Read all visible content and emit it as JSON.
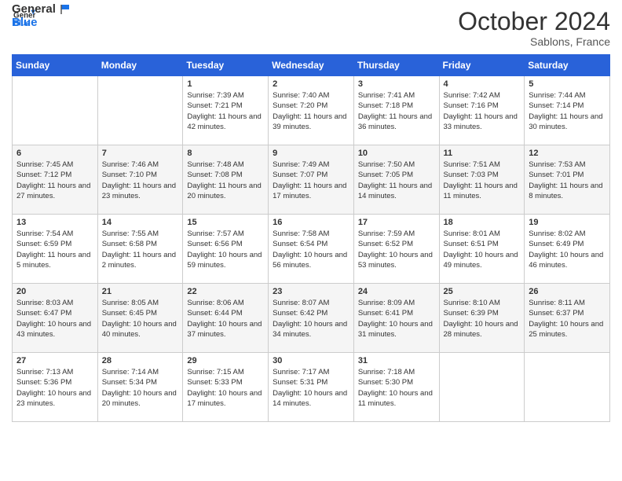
{
  "header": {
    "logo_line1": "General",
    "logo_line2": "Blue",
    "month": "October 2024",
    "location": "Sablons, France"
  },
  "days_of_week": [
    "Sunday",
    "Monday",
    "Tuesday",
    "Wednesday",
    "Thursday",
    "Friday",
    "Saturday"
  ],
  "weeks": [
    [
      {
        "day": "",
        "sunrise": "",
        "sunset": "",
        "daylight": ""
      },
      {
        "day": "",
        "sunrise": "",
        "sunset": "",
        "daylight": ""
      },
      {
        "day": "1",
        "sunrise": "Sunrise: 7:39 AM",
        "sunset": "Sunset: 7:21 PM",
        "daylight": "Daylight: 11 hours and 42 minutes."
      },
      {
        "day": "2",
        "sunrise": "Sunrise: 7:40 AM",
        "sunset": "Sunset: 7:20 PM",
        "daylight": "Daylight: 11 hours and 39 minutes."
      },
      {
        "day": "3",
        "sunrise": "Sunrise: 7:41 AM",
        "sunset": "Sunset: 7:18 PM",
        "daylight": "Daylight: 11 hours and 36 minutes."
      },
      {
        "day": "4",
        "sunrise": "Sunrise: 7:42 AM",
        "sunset": "Sunset: 7:16 PM",
        "daylight": "Daylight: 11 hours and 33 minutes."
      },
      {
        "day": "5",
        "sunrise": "Sunrise: 7:44 AM",
        "sunset": "Sunset: 7:14 PM",
        "daylight": "Daylight: 11 hours and 30 minutes."
      }
    ],
    [
      {
        "day": "6",
        "sunrise": "Sunrise: 7:45 AM",
        "sunset": "Sunset: 7:12 PM",
        "daylight": "Daylight: 11 hours and 27 minutes."
      },
      {
        "day": "7",
        "sunrise": "Sunrise: 7:46 AM",
        "sunset": "Sunset: 7:10 PM",
        "daylight": "Daylight: 11 hours and 23 minutes."
      },
      {
        "day": "8",
        "sunrise": "Sunrise: 7:48 AM",
        "sunset": "Sunset: 7:08 PM",
        "daylight": "Daylight: 11 hours and 20 minutes."
      },
      {
        "day": "9",
        "sunrise": "Sunrise: 7:49 AM",
        "sunset": "Sunset: 7:07 PM",
        "daylight": "Daylight: 11 hours and 17 minutes."
      },
      {
        "day": "10",
        "sunrise": "Sunrise: 7:50 AM",
        "sunset": "Sunset: 7:05 PM",
        "daylight": "Daylight: 11 hours and 14 minutes."
      },
      {
        "day": "11",
        "sunrise": "Sunrise: 7:51 AM",
        "sunset": "Sunset: 7:03 PM",
        "daylight": "Daylight: 11 hours and 11 minutes."
      },
      {
        "day": "12",
        "sunrise": "Sunrise: 7:53 AM",
        "sunset": "Sunset: 7:01 PM",
        "daylight": "Daylight: 11 hours and 8 minutes."
      }
    ],
    [
      {
        "day": "13",
        "sunrise": "Sunrise: 7:54 AM",
        "sunset": "Sunset: 6:59 PM",
        "daylight": "Daylight: 11 hours and 5 minutes."
      },
      {
        "day": "14",
        "sunrise": "Sunrise: 7:55 AM",
        "sunset": "Sunset: 6:58 PM",
        "daylight": "Daylight: 11 hours and 2 minutes."
      },
      {
        "day": "15",
        "sunrise": "Sunrise: 7:57 AM",
        "sunset": "Sunset: 6:56 PM",
        "daylight": "Daylight: 10 hours and 59 minutes."
      },
      {
        "day": "16",
        "sunrise": "Sunrise: 7:58 AM",
        "sunset": "Sunset: 6:54 PM",
        "daylight": "Daylight: 10 hours and 56 minutes."
      },
      {
        "day": "17",
        "sunrise": "Sunrise: 7:59 AM",
        "sunset": "Sunset: 6:52 PM",
        "daylight": "Daylight: 10 hours and 53 minutes."
      },
      {
        "day": "18",
        "sunrise": "Sunrise: 8:01 AM",
        "sunset": "Sunset: 6:51 PM",
        "daylight": "Daylight: 10 hours and 49 minutes."
      },
      {
        "day": "19",
        "sunrise": "Sunrise: 8:02 AM",
        "sunset": "Sunset: 6:49 PM",
        "daylight": "Daylight: 10 hours and 46 minutes."
      }
    ],
    [
      {
        "day": "20",
        "sunrise": "Sunrise: 8:03 AM",
        "sunset": "Sunset: 6:47 PM",
        "daylight": "Daylight: 10 hours and 43 minutes."
      },
      {
        "day": "21",
        "sunrise": "Sunrise: 8:05 AM",
        "sunset": "Sunset: 6:45 PM",
        "daylight": "Daylight: 10 hours and 40 minutes."
      },
      {
        "day": "22",
        "sunrise": "Sunrise: 8:06 AM",
        "sunset": "Sunset: 6:44 PM",
        "daylight": "Daylight: 10 hours and 37 minutes."
      },
      {
        "day": "23",
        "sunrise": "Sunrise: 8:07 AM",
        "sunset": "Sunset: 6:42 PM",
        "daylight": "Daylight: 10 hours and 34 minutes."
      },
      {
        "day": "24",
        "sunrise": "Sunrise: 8:09 AM",
        "sunset": "Sunset: 6:41 PM",
        "daylight": "Daylight: 10 hours and 31 minutes."
      },
      {
        "day": "25",
        "sunrise": "Sunrise: 8:10 AM",
        "sunset": "Sunset: 6:39 PM",
        "daylight": "Daylight: 10 hours and 28 minutes."
      },
      {
        "day": "26",
        "sunrise": "Sunrise: 8:11 AM",
        "sunset": "Sunset: 6:37 PM",
        "daylight": "Daylight: 10 hours and 25 minutes."
      }
    ],
    [
      {
        "day": "27",
        "sunrise": "Sunrise: 7:13 AM",
        "sunset": "Sunset: 5:36 PM",
        "daylight": "Daylight: 10 hours and 23 minutes."
      },
      {
        "day": "28",
        "sunrise": "Sunrise: 7:14 AM",
        "sunset": "Sunset: 5:34 PM",
        "daylight": "Daylight: 10 hours and 20 minutes."
      },
      {
        "day": "29",
        "sunrise": "Sunrise: 7:15 AM",
        "sunset": "Sunset: 5:33 PM",
        "daylight": "Daylight: 10 hours and 17 minutes."
      },
      {
        "day": "30",
        "sunrise": "Sunrise: 7:17 AM",
        "sunset": "Sunset: 5:31 PM",
        "daylight": "Daylight: 10 hours and 14 minutes."
      },
      {
        "day": "31",
        "sunrise": "Sunrise: 7:18 AM",
        "sunset": "Sunset: 5:30 PM",
        "daylight": "Daylight: 10 hours and 11 minutes."
      },
      {
        "day": "",
        "sunrise": "",
        "sunset": "",
        "daylight": ""
      },
      {
        "day": "",
        "sunrise": "",
        "sunset": "",
        "daylight": ""
      }
    ]
  ]
}
